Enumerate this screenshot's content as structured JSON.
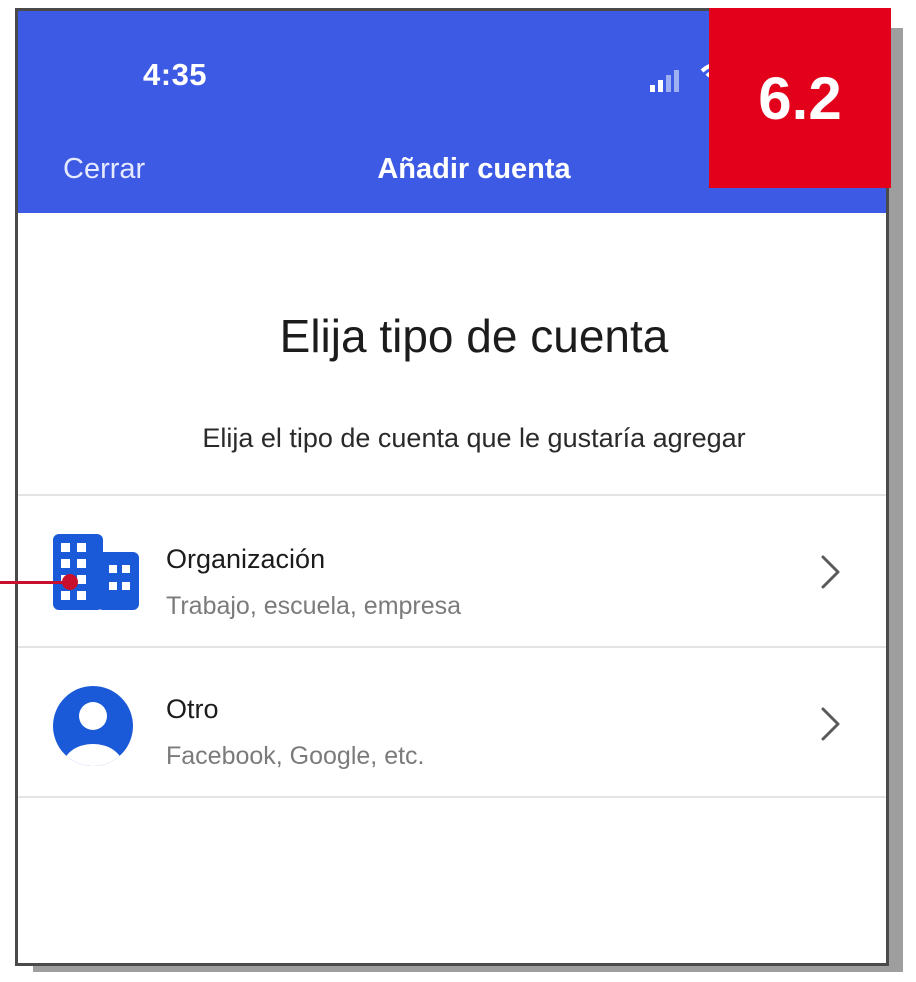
{
  "status_bar": {
    "time": "4:35"
  },
  "nav": {
    "close_label": "Cerrar",
    "title": "Añadir cuenta"
  },
  "main": {
    "heading": "Elija tipo de cuenta",
    "subtitle": "Elija el tipo de cuenta que le gustaría agregar"
  },
  "options": [
    {
      "title": "Organización",
      "subtitle": "Trabajo, escuela, empresa",
      "icon": "building-icon"
    },
    {
      "title": "Otro",
      "subtitle": "Facebook, Google, etc.",
      "icon": "person-icon"
    }
  ],
  "badge": {
    "label": "6.2"
  },
  "colors": {
    "header": "#3d5ae5",
    "icon": "#1a5ad8",
    "badge": "#e3001b",
    "callout": "#c8102e"
  }
}
